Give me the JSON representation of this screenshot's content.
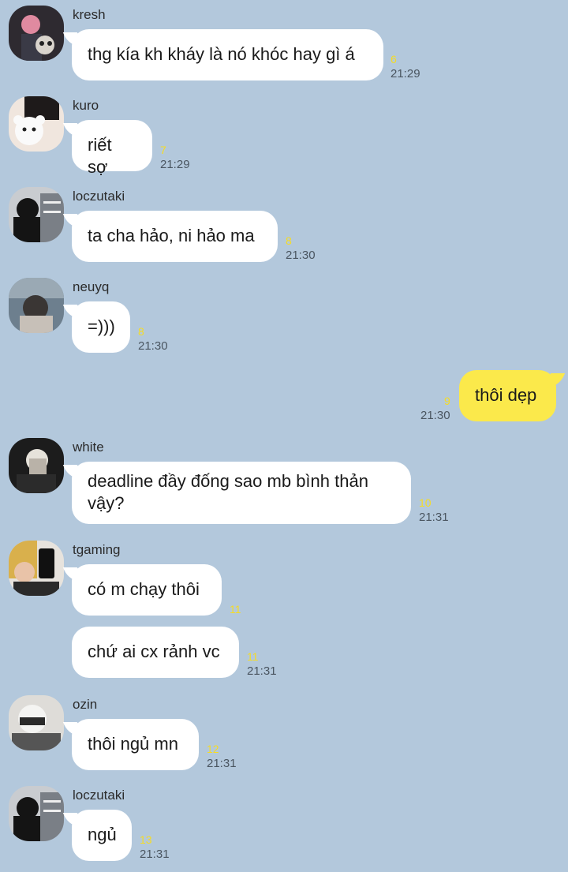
{
  "messages": [
    {
      "sender": "kresh",
      "text": "thg kía kh kháy là nó khóc hay gì á",
      "unread": "6",
      "time": "21:29"
    },
    {
      "sender": "kuro",
      "text": "riết sợ",
      "unread": "7",
      "time": "21:29"
    },
    {
      "sender": "loczutaki",
      "text": "ta cha hảo, ni hảo ma",
      "unread": "8",
      "time": "21:30"
    },
    {
      "sender": "neuyq",
      "text": "=)))",
      "unread": "8",
      "time": "21:30"
    },
    {
      "sender": "",
      "text": "thôi dẹp",
      "unread": "9",
      "time": "21:30"
    },
    {
      "sender": "white",
      "text": "deadline đầy đống sao mb bình thản vậy?",
      "unread": "10",
      "time": "21:31"
    },
    {
      "sender": "tgaming",
      "text": "có m chạy thôi",
      "unread": "11",
      "time": ""
    },
    {
      "sender": "",
      "text": "chứ ai cx rảnh vc",
      "unread": "11",
      "time": "21:31"
    },
    {
      "sender": "ozin",
      "text": "thôi ngủ mn",
      "unread": "12",
      "time": "21:31"
    },
    {
      "sender": "loczutaki",
      "text": "ngủ",
      "unread": "13",
      "time": "21:31"
    }
  ]
}
